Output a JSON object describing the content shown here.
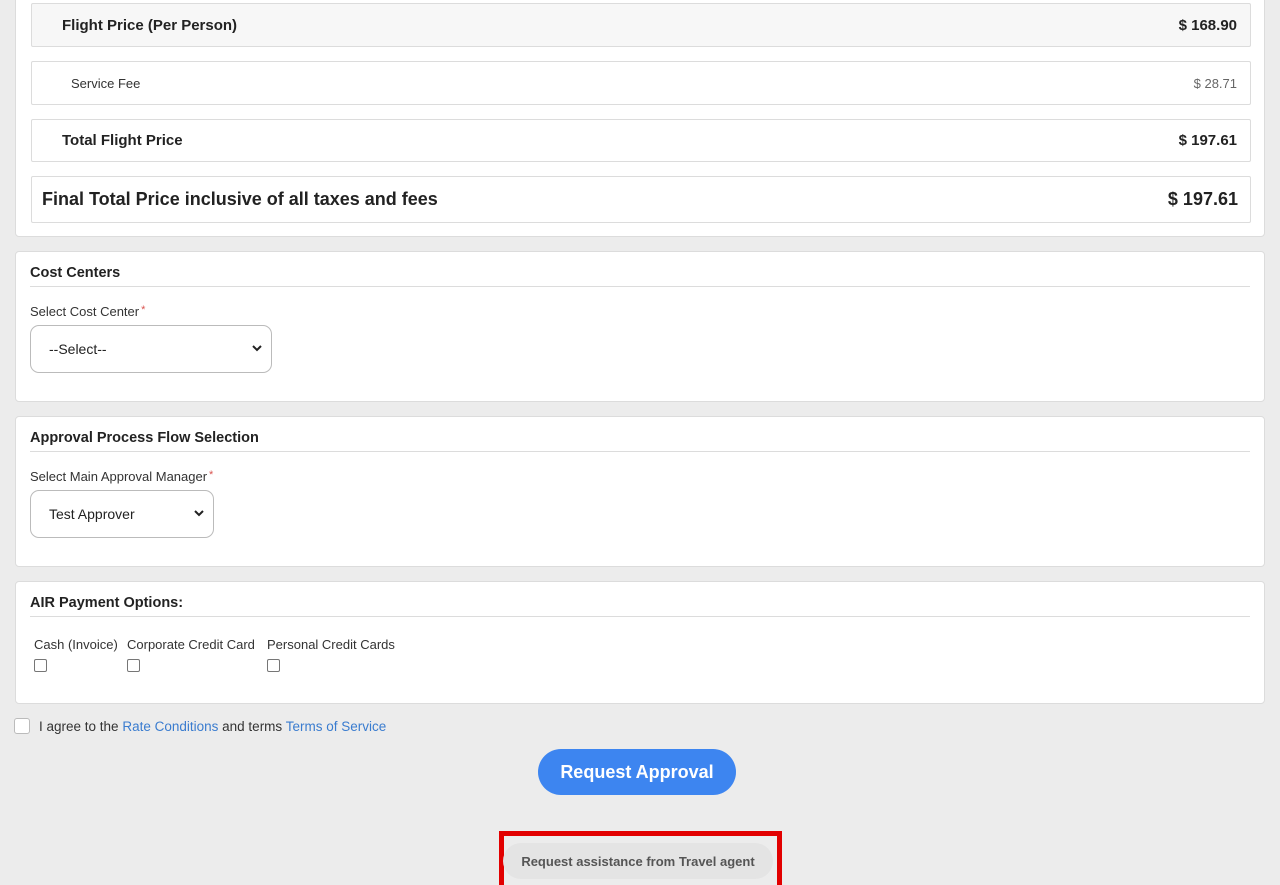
{
  "pricing": {
    "flight_price_label": "Flight Price (Per Person)",
    "flight_price_value": "$ 168.90",
    "service_fee_label": "Service Fee",
    "service_fee_value": "$ 28.71",
    "total_flight_label": "Total Flight Price",
    "total_flight_value": "$ 197.61",
    "final_total_label": "Final Total Price inclusive of all taxes and fees",
    "final_total_value": "$ 197.61"
  },
  "cost_centers": {
    "title": "Cost Centers",
    "select_label": "Select Cost Center",
    "required_marker": "*",
    "selected_value": "--Select--"
  },
  "approval": {
    "title": "Approval Process Flow Selection",
    "select_label": "Select Main Approval Manager",
    "required_marker": "*",
    "selected_value": "Test Approver"
  },
  "payment": {
    "title": "AIR Payment Options:",
    "options": [
      {
        "label": "Cash (Invoice)",
        "checked": false
      },
      {
        "label": "Corporate Credit Card",
        "checked": false
      },
      {
        "label": "Personal Credit Cards",
        "checked": false
      }
    ]
  },
  "agreement": {
    "prefix": "I agree to the",
    "rate_link": "Rate Conditions",
    "middle": "and terms",
    "terms_link": "Terms of Service",
    "checked": false
  },
  "actions": {
    "request_approval": "Request Approval",
    "request_assistance": "Request assistance from Travel agent"
  },
  "colors": {
    "primary": "#3d85f0",
    "link": "#3a7ccf",
    "highlight": "#e20000",
    "required": "#d9534f"
  }
}
